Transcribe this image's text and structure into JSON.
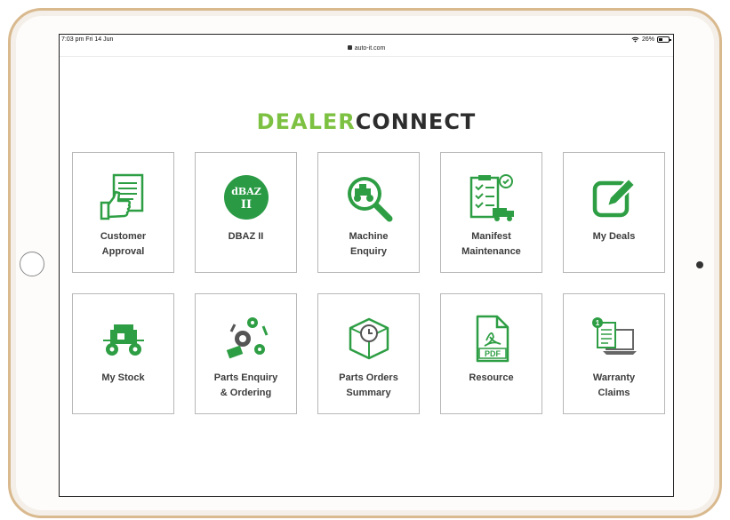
{
  "status": {
    "time": "7:03 pm  Fri 14 Jun",
    "url": "auto-it.com",
    "battery": "26%"
  },
  "logo": {
    "dealer": "DEALER",
    "connect": "CONNECT"
  },
  "tiles": [
    {
      "line1": "Customer",
      "line2": "Approval"
    },
    {
      "line1": "DBAZ II",
      "line2": ""
    },
    {
      "line1": "Machine",
      "line2": "Enquiry"
    },
    {
      "line1": "Manifest",
      "line2": "Maintenance"
    },
    {
      "line1": "My Deals",
      "line2": ""
    },
    {
      "line1": "My Stock",
      "line2": ""
    },
    {
      "line1": "Parts Enquiry",
      "line2": "& Ordering"
    },
    {
      "line1": "Parts Orders",
      "line2": "Summary"
    },
    {
      "line1": "Resource",
      "line2": ""
    },
    {
      "line1": "Warranty",
      "line2": "Claims"
    }
  ],
  "icons": {
    "dbaz_top": "dBAZ",
    "dbaz_bottom": "II",
    "pdf_text": "PDF",
    "warranty_badge": "1"
  },
  "colors": {
    "brand_green": "#7dc142",
    "icon_green": "#2e9e44",
    "text_dark": "#3c3c3c"
  }
}
